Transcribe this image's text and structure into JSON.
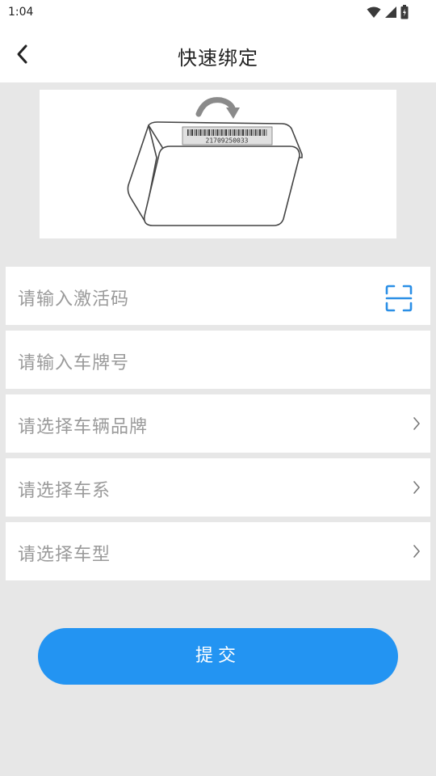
{
  "status_bar": {
    "time": "1:04",
    "icons": [
      "wifi-icon",
      "signal-icon",
      "battery-icon"
    ]
  },
  "header": {
    "back_icon": "chevron-left-icon",
    "title": "快速绑定"
  },
  "device_illustration": {
    "barcode_number": "21709250033",
    "arrow_icon": "curved-arrow-icon"
  },
  "form": {
    "activation_code": {
      "placeholder": "请输入激活码",
      "action_icon": "scan-icon"
    },
    "plate_number": {
      "placeholder": "请输入车牌号"
    },
    "car_brand": {
      "placeholder": "请选择车辆品牌",
      "icon": "chevron-right-icon"
    },
    "car_series": {
      "placeholder": "请选择车系",
      "icon": "chevron-right-icon"
    },
    "car_model": {
      "placeholder": "请选择车型",
      "icon": "chevron-right-icon"
    }
  },
  "submit": {
    "label": "提交"
  },
  "colors": {
    "primary": "#2394f2",
    "background": "#e7e7e7",
    "placeholder": "#9a9a9a"
  }
}
